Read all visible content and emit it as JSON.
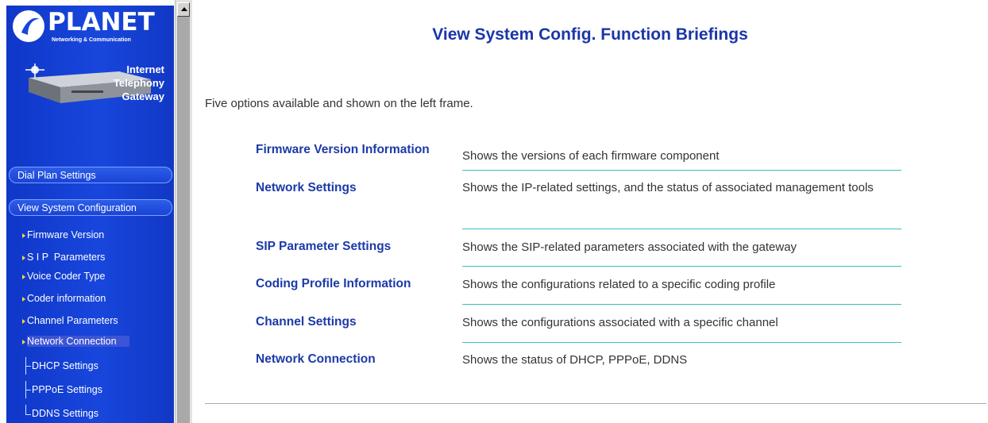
{
  "brand": {
    "logo_text": "PLANET",
    "logo_subtext": "Networking & Communication",
    "product_lines": [
      "Internet",
      "Telephony",
      "Gateway"
    ]
  },
  "sidebar": {
    "buttons": [
      "Dial Plan Settings",
      "View System Configuration"
    ],
    "sub_items": [
      "Firmware Version",
      "S I P  Parameters",
      "Voice Coder Type",
      "Coder information",
      "Channel Parameters",
      "Network Connection"
    ],
    "tree_items": [
      "DHCP Settings",
      "PPPoE Settings",
      "DDNS Settings"
    ]
  },
  "main": {
    "title": "View System Config. Function Briefings",
    "intro": "Five options available and shown on the left frame.",
    "rows": [
      {
        "name": "Firmware Version Information",
        "desc": "Shows the versions of each firmware component"
      },
      {
        "name": "Network Settings",
        "desc": "Shows the IP-related settings, and the status of associated management tools"
      },
      {
        "name": "SIP Parameter Settings",
        "desc": "Shows the SIP-related parameters associated with the gateway"
      },
      {
        "name": "Coding Profile Information",
        "desc": "Shows the configurations related to a specific coding profile"
      },
      {
        "name": "Channel Settings",
        "desc": "Shows the configurations associated with a specific channel"
      },
      {
        "name": "Network Connection",
        "desc": "Shows the status of DHCP, PPPoE, DDNS"
      }
    ]
  },
  "colors": {
    "sidebar_blue": "#1846dc",
    "heading_blue": "#1a36a8",
    "divider_teal": "#3ac0bc"
  }
}
